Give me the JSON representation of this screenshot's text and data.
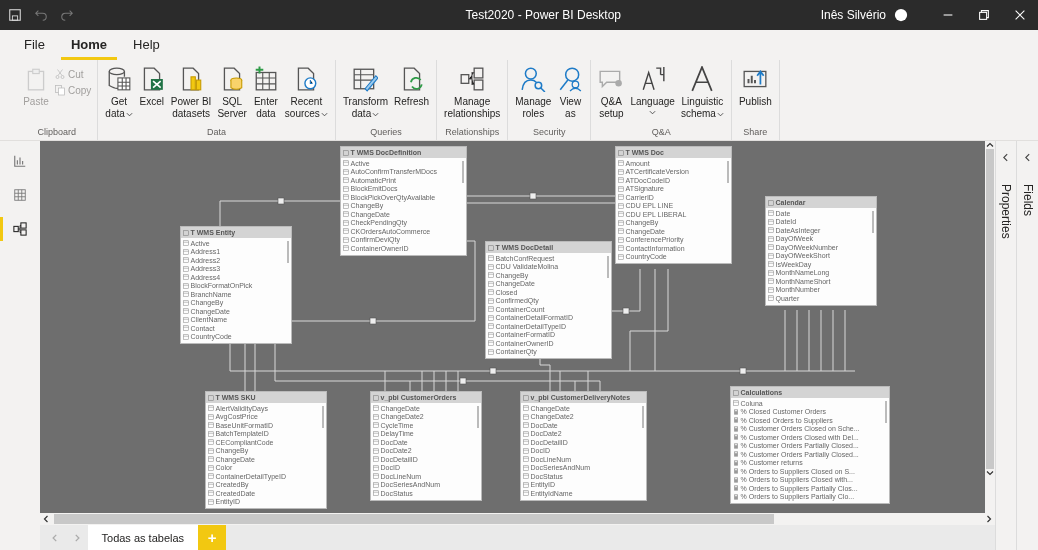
{
  "window": {
    "title": "Test2020 - Power BI Desktop",
    "user": "Inês Silvério"
  },
  "menu": [
    {
      "label": "File",
      "selected": false
    },
    {
      "label": "Home",
      "selected": true
    },
    {
      "label": "Help",
      "selected": false
    }
  ],
  "ribbon": {
    "groups": [
      {
        "label": "Clipboard",
        "buttons": [
          {
            "kind": "large",
            "lines": [
              "Paste"
            ],
            "dropdown": false,
            "disabled": true
          },
          {
            "kind": "small",
            "lines": [
              "Cut"
            ],
            "dropdown": false,
            "disabled": true
          },
          {
            "kind": "small",
            "lines": [
              "Copy"
            ],
            "dropdown": false,
            "disabled": true
          }
        ]
      },
      {
        "label": "Data",
        "buttons": [
          {
            "kind": "large",
            "lines": [
              "Get",
              "data"
            ],
            "dropdown": true,
            "disabled": false
          },
          {
            "kind": "large",
            "lines": [
              "Excel"
            ],
            "dropdown": false,
            "disabled": false
          },
          {
            "kind": "large",
            "lines": [
              "Power BI",
              "datasets"
            ],
            "dropdown": false,
            "disabled": false
          },
          {
            "kind": "large",
            "lines": [
              "SQL",
              "Server"
            ],
            "dropdown": false,
            "disabled": false
          },
          {
            "kind": "large",
            "lines": [
              "Enter",
              "data"
            ],
            "dropdown": false,
            "disabled": false
          },
          {
            "kind": "large",
            "lines": [
              "Recent",
              "sources"
            ],
            "dropdown": true,
            "disabled": false
          }
        ]
      },
      {
        "label": "Queries",
        "buttons": [
          {
            "kind": "large",
            "lines": [
              "Transform",
              "data"
            ],
            "dropdown": true,
            "disabled": false
          },
          {
            "kind": "large",
            "lines": [
              "Refresh"
            ],
            "dropdown": false,
            "disabled": false
          }
        ]
      },
      {
        "label": "Relationships",
        "buttons": [
          {
            "kind": "large",
            "lines": [
              "Manage",
              "relationships"
            ],
            "dropdown": false,
            "disabled": false
          }
        ]
      },
      {
        "label": "Security",
        "buttons": [
          {
            "kind": "large",
            "lines": [
              "Manage",
              "roles"
            ],
            "dropdown": false,
            "disabled": false
          },
          {
            "kind": "large",
            "lines": [
              "View",
              "as"
            ],
            "dropdown": false,
            "disabled": false
          }
        ]
      },
      {
        "label": "Q&A",
        "buttons": [
          {
            "kind": "large",
            "lines": [
              "Q&A",
              "setup"
            ],
            "dropdown": false,
            "disabled": false
          },
          {
            "kind": "large",
            "lines": [
              "Language"
            ],
            "dropdown": true,
            "disabled": false
          },
          {
            "kind": "large",
            "lines": [
              "Linguistic",
              "schema"
            ],
            "dropdown": true,
            "disabled": false
          }
        ]
      },
      {
        "label": "Share",
        "buttons": [
          {
            "kind": "large",
            "lines": [
              "Publish"
            ],
            "dropdown": false,
            "disabled": false
          }
        ]
      }
    ]
  },
  "sidebar": {
    "views": [
      {
        "selected": false
      },
      {
        "selected": false
      },
      {
        "selected": true
      }
    ]
  },
  "tables": [
    {
      "name": "T WMS DocDefinition",
      "fields": [
        "Active",
        "AutoConfirmTransferMDocs",
        "AutomaticPrint",
        "BlockEmitDocs",
        "BlockPickOverQtyAvailable",
        "ChangeBy",
        "ChangeDate",
        "CheckPendingQty",
        "CKOrdersAutoCommerce",
        "ConfirmDeviQty",
        "ContainerOwnerID"
      ]
    },
    {
      "name": "T WMS Doc",
      "fields": [
        "Amount",
        "ATCertificateVersion",
        "ATDocCodeID",
        "ATSignature",
        "CarrierID",
        "CDU EPL LINE",
        "CDU EPL LIBERAL",
        "ChangeBy",
        "ChangeDate",
        "ConferencePriority",
        "ContactInformation",
        "CountryCode"
      ]
    },
    {
      "name": "T WMS Entity",
      "fields": [
        "Active",
        "Address1",
        "Address2",
        "Address3",
        "Address4",
        "BlockFormatOnPick",
        "BranchName",
        "ChangeBy",
        "ChangeDate",
        "ClientName",
        "Contact",
        "CountryCode"
      ]
    },
    {
      "name": "T WMS DocDetail",
      "fields": [
        "BatchConfRequest",
        "CDU ValidateMolina",
        "ChangeBy",
        "ChangeDate",
        "Closed",
        "ConfirmedQty",
        "ContainerCount",
        "ContainerDetailFormatID",
        "ContainerDetailTypeID",
        "ContainerFormatID",
        "ContainerOwnerID",
        "ContainerQty"
      ]
    },
    {
      "name": "Calendar",
      "fields": [
        "Date",
        "DateId",
        "DateAsInteger",
        "DayOfWeek",
        "DayOfWeekNumber",
        "DayOfWeekShort",
        "IsWeekDay",
        "MonthNameLong",
        "MonthNameShort",
        "MonthNumber",
        "Quarter"
      ]
    },
    {
      "name": "T WMS SKU",
      "fields": [
        "AlertValidityDays",
        "AvgCostPrice",
        "BaseUnitFormatID",
        "BatchTemplateID",
        "CECompliantCode",
        "ChangeBy",
        "ChangeDate",
        "Color",
        "ContainerDetailTypeID",
        "CreatedBy",
        "CreatedDate",
        "EntityID"
      ]
    },
    {
      "name": "v_pbi CustomerOrders",
      "fields": [
        "ChangeDate",
        "ChangeDate2",
        "CycleTime",
        "DelayTime",
        "DocDate",
        "DocDate2",
        "DocDetailID",
        "DocID",
        "DocLineNum",
        "DocSeriesAndNum",
        "DocStatus"
      ]
    },
    {
      "name": "v_pbi CustomerDeliveryNotes",
      "fields": [
        "ChangeDate",
        "ChangeDate2",
        "DocDate",
        "DocDate2",
        "DocDetailID",
        "DocID",
        "DocLineNum",
        "DocSeriesAndNum",
        "DocStatus",
        "EntityID",
        "EntityIdName"
      ]
    },
    {
      "name": "Calculations",
      "fields": [
        "Coluna"
      ],
      "measures": [
        "% Closed Customer Orders",
        "% Closed Orders to Suppliers",
        "% Customer Orders Closed on Sche...",
        "% Customer Orders Closed with Del...",
        "% Customer Orders Partially Closed...",
        "% Customer Orders Partially Closed...",
        "% Customer returns",
        "% Orders to Suppliers Closed on S...",
        "% Orders to Suppliers Closed with...",
        "% Orders to Suppliers Partially Clos...",
        "% Orders to Suppliers Partially Clo..."
      ]
    }
  ],
  "panes": [
    {
      "label": "Properties"
    },
    {
      "label": "Fields"
    }
  ],
  "page_tabs": [
    {
      "label": "Todas as tabelas",
      "selected": true
    }
  ],
  "add_tab": "+"
}
